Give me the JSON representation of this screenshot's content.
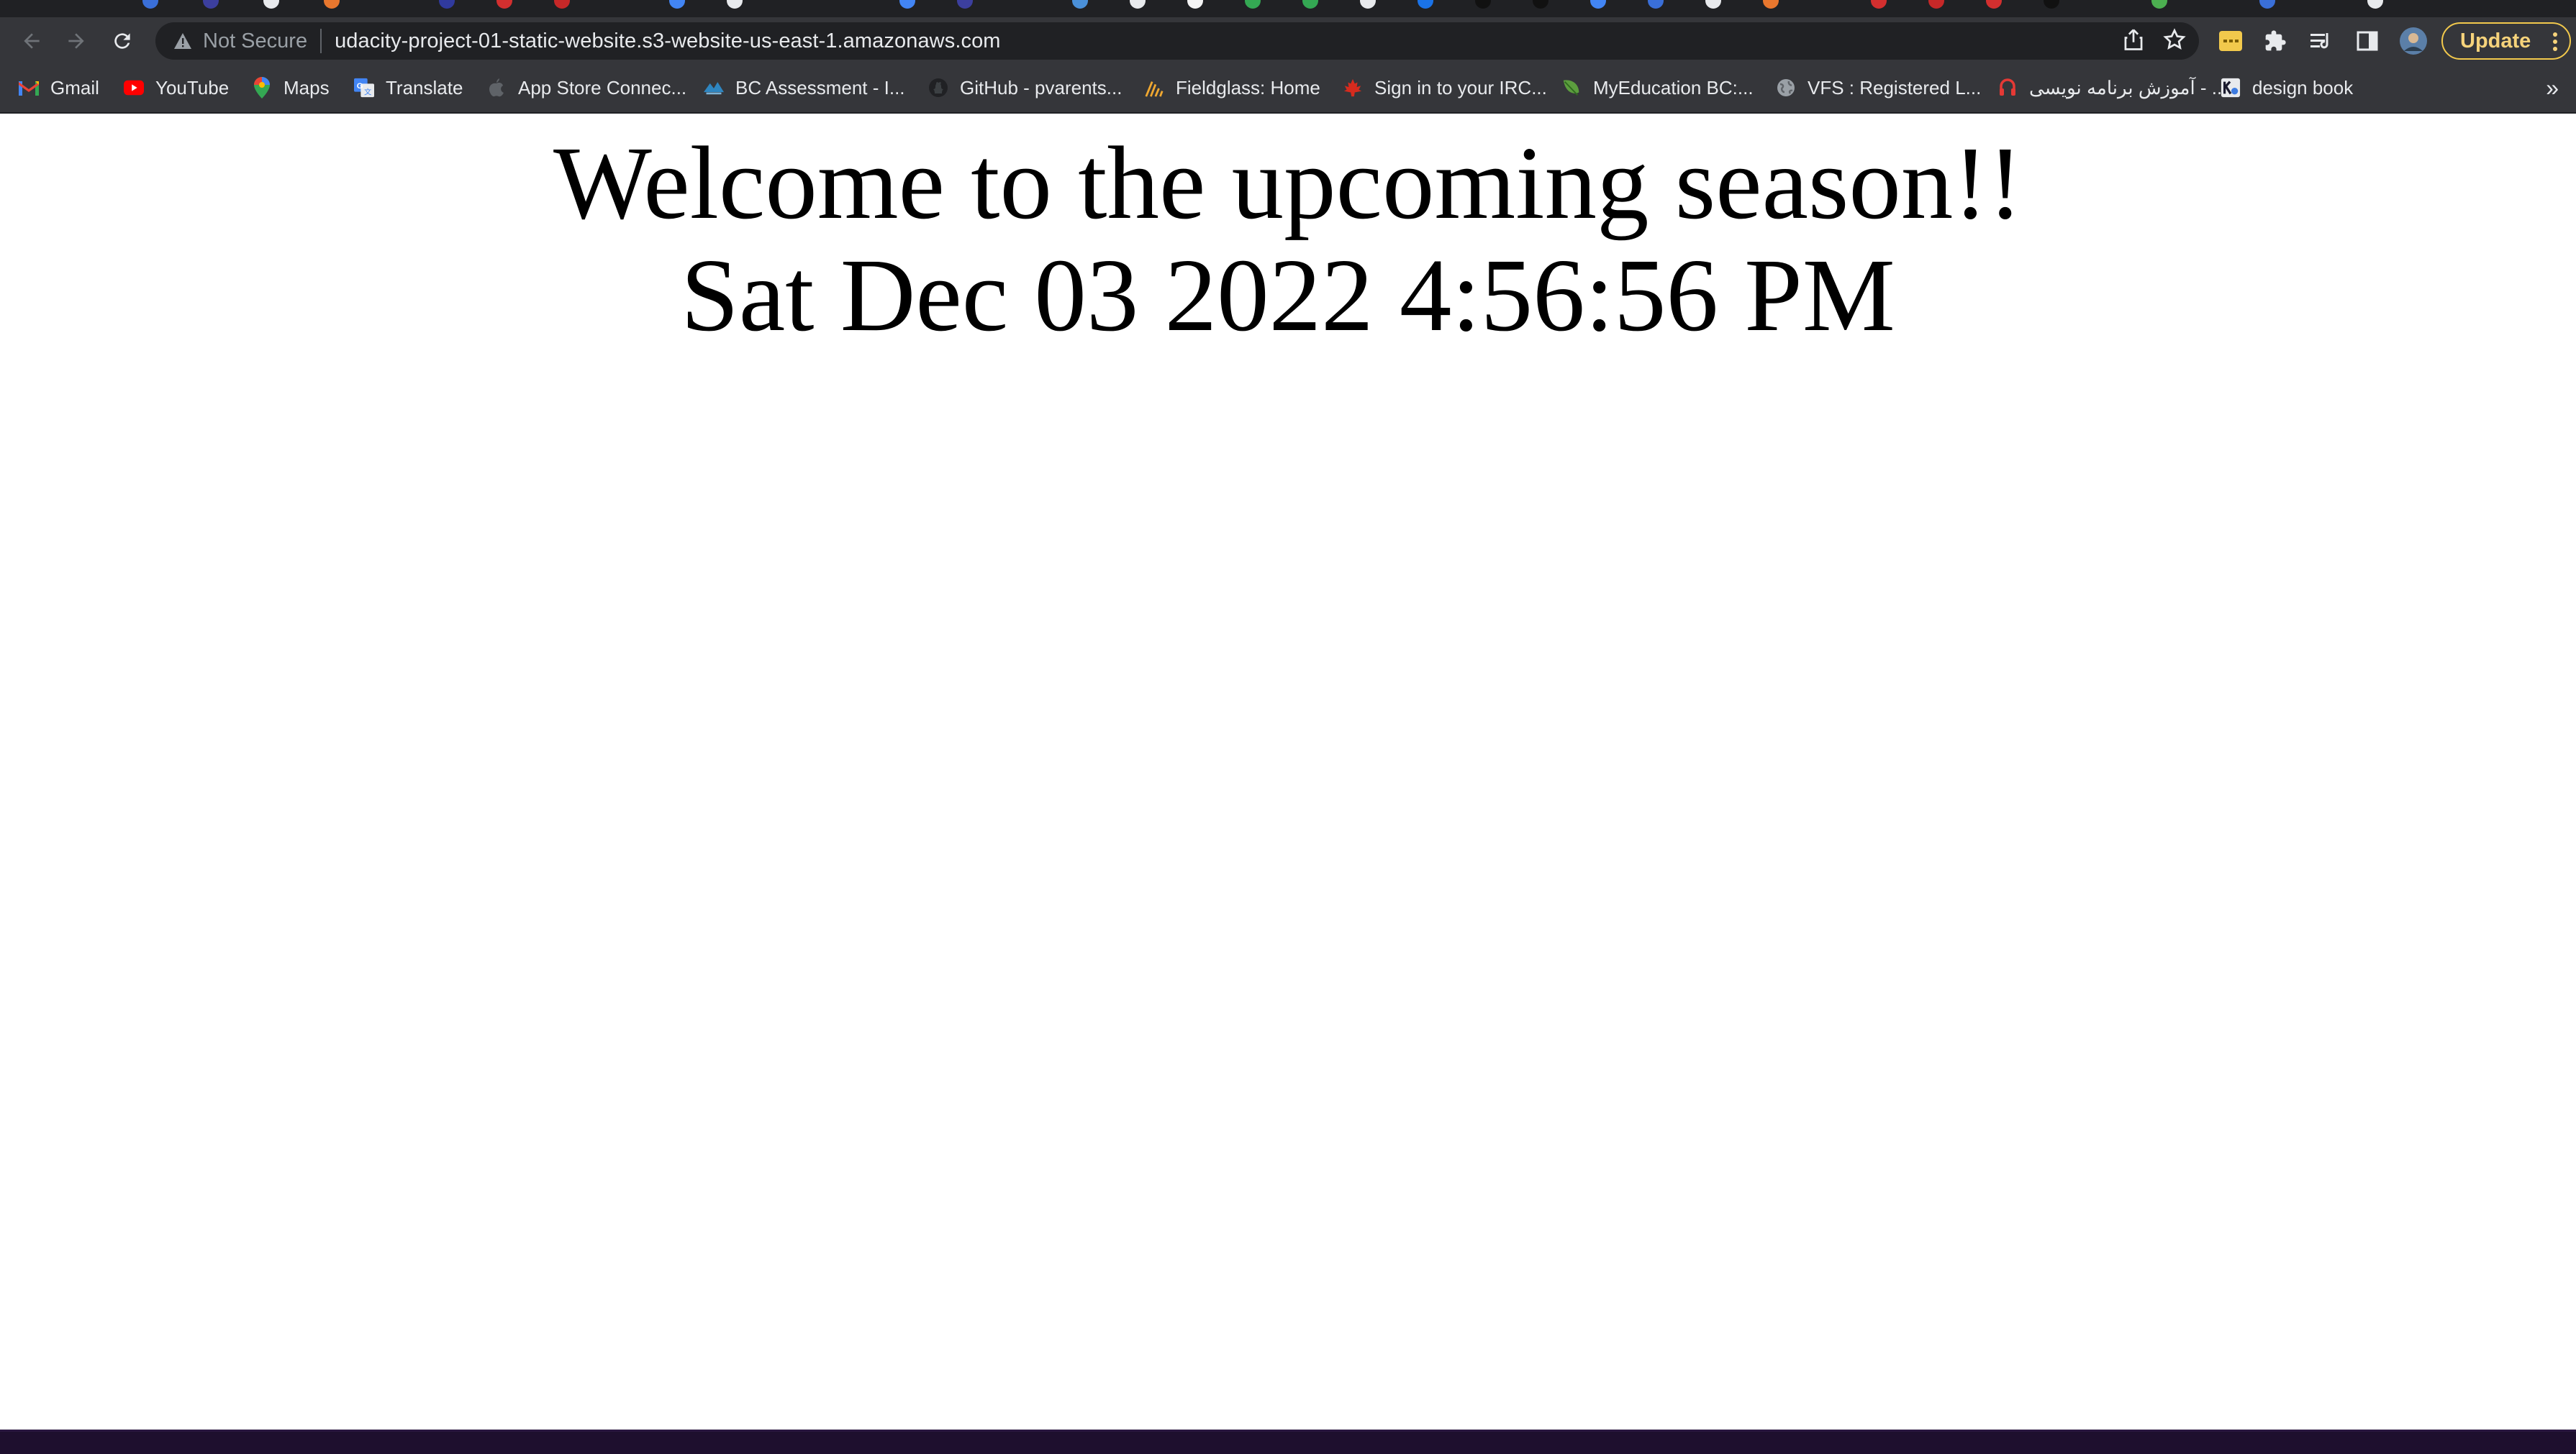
{
  "toolbar": {
    "security_label": "Not Secure",
    "url": "udacity-project-01-static-website.s3-website-us-east-1.amazonaws.com",
    "update_label": "Update"
  },
  "bookmarks": [
    {
      "label": "Gmail",
      "icon": "gmail-icon"
    },
    {
      "label": "YouTube",
      "icon": "youtube-icon"
    },
    {
      "label": "Maps",
      "icon": "maps-pin-icon"
    },
    {
      "label": "Translate",
      "icon": "translate-icon"
    },
    {
      "label": "App Store Connec...",
      "icon": "apple-icon"
    },
    {
      "label": "BC Assessment - I...",
      "icon": "bc-assessment-icon"
    },
    {
      "label": "GitHub - pvarents...",
      "icon": "github-icon"
    },
    {
      "label": "Fieldglass: Home",
      "icon": "fieldglass-icon"
    },
    {
      "label": "Sign in to your IRC...",
      "icon": "maple-leaf-icon"
    },
    {
      "label": "MyEducation BC:...",
      "icon": "leaf-icon"
    },
    {
      "label": "VFS : Registered L...",
      "icon": "globe-icon"
    },
    {
      "label": "آموزش برنامه نویسی - ...",
      "icon": "headphones-icon"
    },
    {
      "label": "design book",
      "icon": "design-book-icon"
    }
  ],
  "page": {
    "headline": "Welcome to the upcoming season!!",
    "datetime": "Sat Dec 03 2022 4:56:56 PM"
  },
  "colors": {
    "chrome_dark": "#202124",
    "chrome_toolbar": "#35363a",
    "update_accent": "#f2c94c",
    "page_background": "#ffffff",
    "text": "#000000"
  }
}
